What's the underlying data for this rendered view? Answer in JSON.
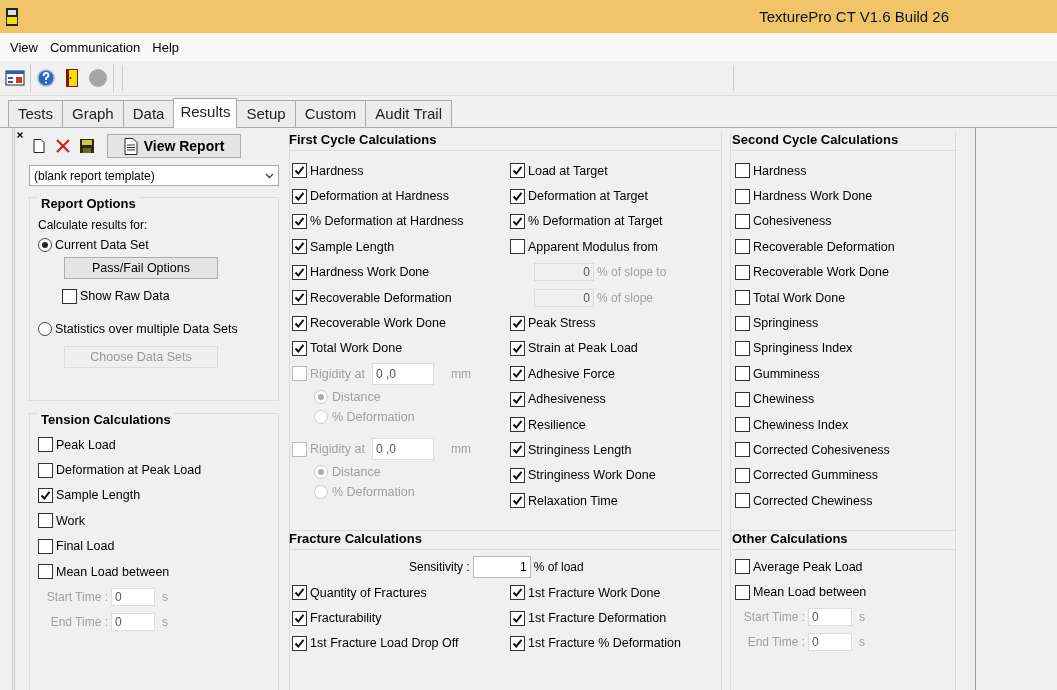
{
  "title_bar": {
    "title": "TexturePro CT V1.6 Build 26"
  },
  "menu": [
    {
      "label": "View"
    },
    {
      "label": "Communication"
    },
    {
      "label": "Help"
    }
  ],
  "tabs": [
    {
      "label": "Tests",
      "selected": false
    },
    {
      "label": "Graph",
      "selected": false
    },
    {
      "label": "Data",
      "selected": false
    },
    {
      "label": "Results",
      "selected": true
    },
    {
      "label": "Setup",
      "selected": false
    },
    {
      "label": "Custom",
      "selected": false
    },
    {
      "label": "Audit Trail",
      "selected": false
    }
  ],
  "report_panel": {
    "view_report": "View Report",
    "template": "(blank report template)",
    "report_options": {
      "title": "Report Options",
      "prompt": "Calculate results for:",
      "modes": [
        {
          "label": "Current Data Set",
          "selected": true
        },
        {
          "label": "Statistics over multiple Data Sets",
          "selected": false
        }
      ],
      "pass_fail_button": {
        "label": "Pass/Fail Options",
        "disabled": false
      },
      "show_raw_data": {
        "label": "Show Raw Data",
        "checked": false
      },
      "choose_button": {
        "label": "Choose Data Sets",
        "disabled": true
      }
    },
    "tension": {
      "title": "Tension Calculations",
      "items": [
        {
          "kind": "check",
          "label": "Peak Load",
          "checked": false
        },
        {
          "kind": "check",
          "label": "Deformation at Peak Load",
          "checked": false
        },
        {
          "kind": "check",
          "label": "Sample Length",
          "checked": true
        },
        {
          "kind": "check",
          "label": "Work",
          "checked": false
        },
        {
          "kind": "check",
          "label": "Final Load",
          "checked": false
        },
        {
          "kind": "time_range",
          "label": "Mean Load between",
          "checked": false,
          "disabled": true,
          "fields": [
            {
              "label": "Start Time :",
              "value": "0",
              "unit": "s"
            },
            {
              "label": "End Time :",
              "value": "0",
              "unit": "s"
            }
          ]
        }
      ]
    }
  },
  "first_cycle": {
    "title": "First Cycle Calculations",
    "left": [
      {
        "kind": "check",
        "label": "Hardness",
        "checked": true
      },
      {
        "kind": "check",
        "label": "Deformation at Hardness",
        "checked": true
      },
      {
        "kind": "check",
        "label": "% Deformation at Hardness",
        "checked": true
      },
      {
        "kind": "check",
        "label": "Sample Length",
        "checked": true
      },
      {
        "kind": "check",
        "label": "Hardness Work Done",
        "checked": true
      },
      {
        "kind": "check",
        "label": "Recoverable Deformation",
        "checked": true
      },
      {
        "kind": "check",
        "label": "Recoverable Work Done",
        "checked": true
      },
      {
        "kind": "check",
        "label": "Total Work Done",
        "checked": true
      },
      {
        "kind": "rigidity",
        "label": "Rigidity at",
        "checked": false,
        "disabled": true,
        "value": "0 ,0",
        "unit": "mm",
        "options": [
          {
            "label": "Distance",
            "selected": true
          },
          {
            "label": "% Deformation",
            "selected": false
          }
        ]
      },
      {
        "kind": "rigidity",
        "label": "Rigidity at",
        "checked": false,
        "disabled": true,
        "value": "0 ,0",
        "unit": "mm",
        "options": [
          {
            "label": "Distance",
            "selected": true
          },
          {
            "label": "% Deformation",
            "selected": false
          }
        ]
      }
    ],
    "right": [
      {
        "kind": "check",
        "label": "Load at Target",
        "checked": true
      },
      {
        "kind": "check",
        "label": "Deformation at Target",
        "checked": true
      },
      {
        "kind": "check",
        "label": "% Deformation at Target",
        "checked": true
      },
      {
        "kind": "check",
        "label": "Apparent Modulus from",
        "checked": false
      },
      {
        "kind": "field",
        "value": "0",
        "unit": "% of slope to",
        "disabled": true
      },
      {
        "kind": "field",
        "value": "0",
        "unit": "% of slope",
        "disabled": true
      },
      {
        "kind": "check",
        "label": "Peak Stress",
        "checked": true
      },
      {
        "kind": "check",
        "label": "Strain at Peak Load",
        "checked": true
      },
      {
        "kind": "check",
        "label": "Adhesive Force",
        "checked": true
      },
      {
        "kind": "check",
        "label": "Adhesiveness",
        "checked": true
      },
      {
        "kind": "check",
        "label": "Resilience",
        "checked": true
      },
      {
        "kind": "check",
        "label": "Stringiness Length",
        "checked": true
      },
      {
        "kind": "check",
        "label": "Stringiness Work Done",
        "checked": true
      },
      {
        "kind": "check",
        "label": "Relaxation Time",
        "checked": true
      }
    ]
  },
  "second_cycle": {
    "title": "Second Cycle Calculations",
    "items": [
      {
        "kind": "check",
        "label": "Hardness",
        "checked": false
      },
      {
        "kind": "check",
        "label": "Hardness Work Done",
        "checked": false
      },
      {
        "kind": "check",
        "label": "Cohesiveness",
        "checked": false
      },
      {
        "kind": "check",
        "label": "Recoverable Deformation",
        "checked": false
      },
      {
        "kind": "check",
        "label": "Recoverable Work Done",
        "checked": false
      },
      {
        "kind": "check",
        "label": "Total Work Done",
        "checked": false
      },
      {
        "kind": "check",
        "label": "Springiness",
        "checked": false
      },
      {
        "kind": "check",
        "label": "Springiness Index",
        "checked": false
      },
      {
        "kind": "check",
        "label": "Gumminess",
        "checked": false
      },
      {
        "kind": "check",
        "label": "Chewiness",
        "checked": false
      },
      {
        "kind": "check",
        "label": "Chewiness Index",
        "checked": false
      },
      {
        "kind": "check",
        "label": "Corrected Cohesiveness",
        "checked": false
      },
      {
        "kind": "check",
        "label": "Corrected Gumminess",
        "checked": false
      },
      {
        "kind": "check",
        "label": "Corrected Chewiness",
        "checked": false
      }
    ]
  },
  "fracture": {
    "title": "Fracture Calculations",
    "sensitivity": {
      "label": "Sensitivity :",
      "value": "1",
      "unit": "% of load"
    },
    "left": [
      {
        "kind": "check",
        "label": "Quantity of Fractures",
        "checked": true
      },
      {
        "kind": "check",
        "label": "Fracturability",
        "checked": true
      },
      {
        "kind": "check",
        "label": "1st Fracture Load Drop Off",
        "checked": true
      }
    ],
    "right": [
      {
        "kind": "check",
        "label": "1st Fracture Work Done",
        "checked": true
      },
      {
        "kind": "check",
        "label": "1st Fracture Deformation",
        "checked": true
      },
      {
        "kind": "check",
        "label": "1st Fracture % Deformation",
        "checked": true
      }
    ]
  },
  "other": {
    "title": "Other Calculations",
    "items": [
      {
        "kind": "check",
        "label": "Average Peak Load",
        "checked": false
      },
      {
        "kind": "time_range",
        "label": "Mean Load between",
        "checked": false,
        "disabled": true,
        "fields": [
          {
            "label": "Start Time :",
            "value": "0",
            "unit": "s"
          },
          {
            "label": "End Time :",
            "value": "0",
            "unit": "s"
          }
        ]
      }
    ]
  }
}
